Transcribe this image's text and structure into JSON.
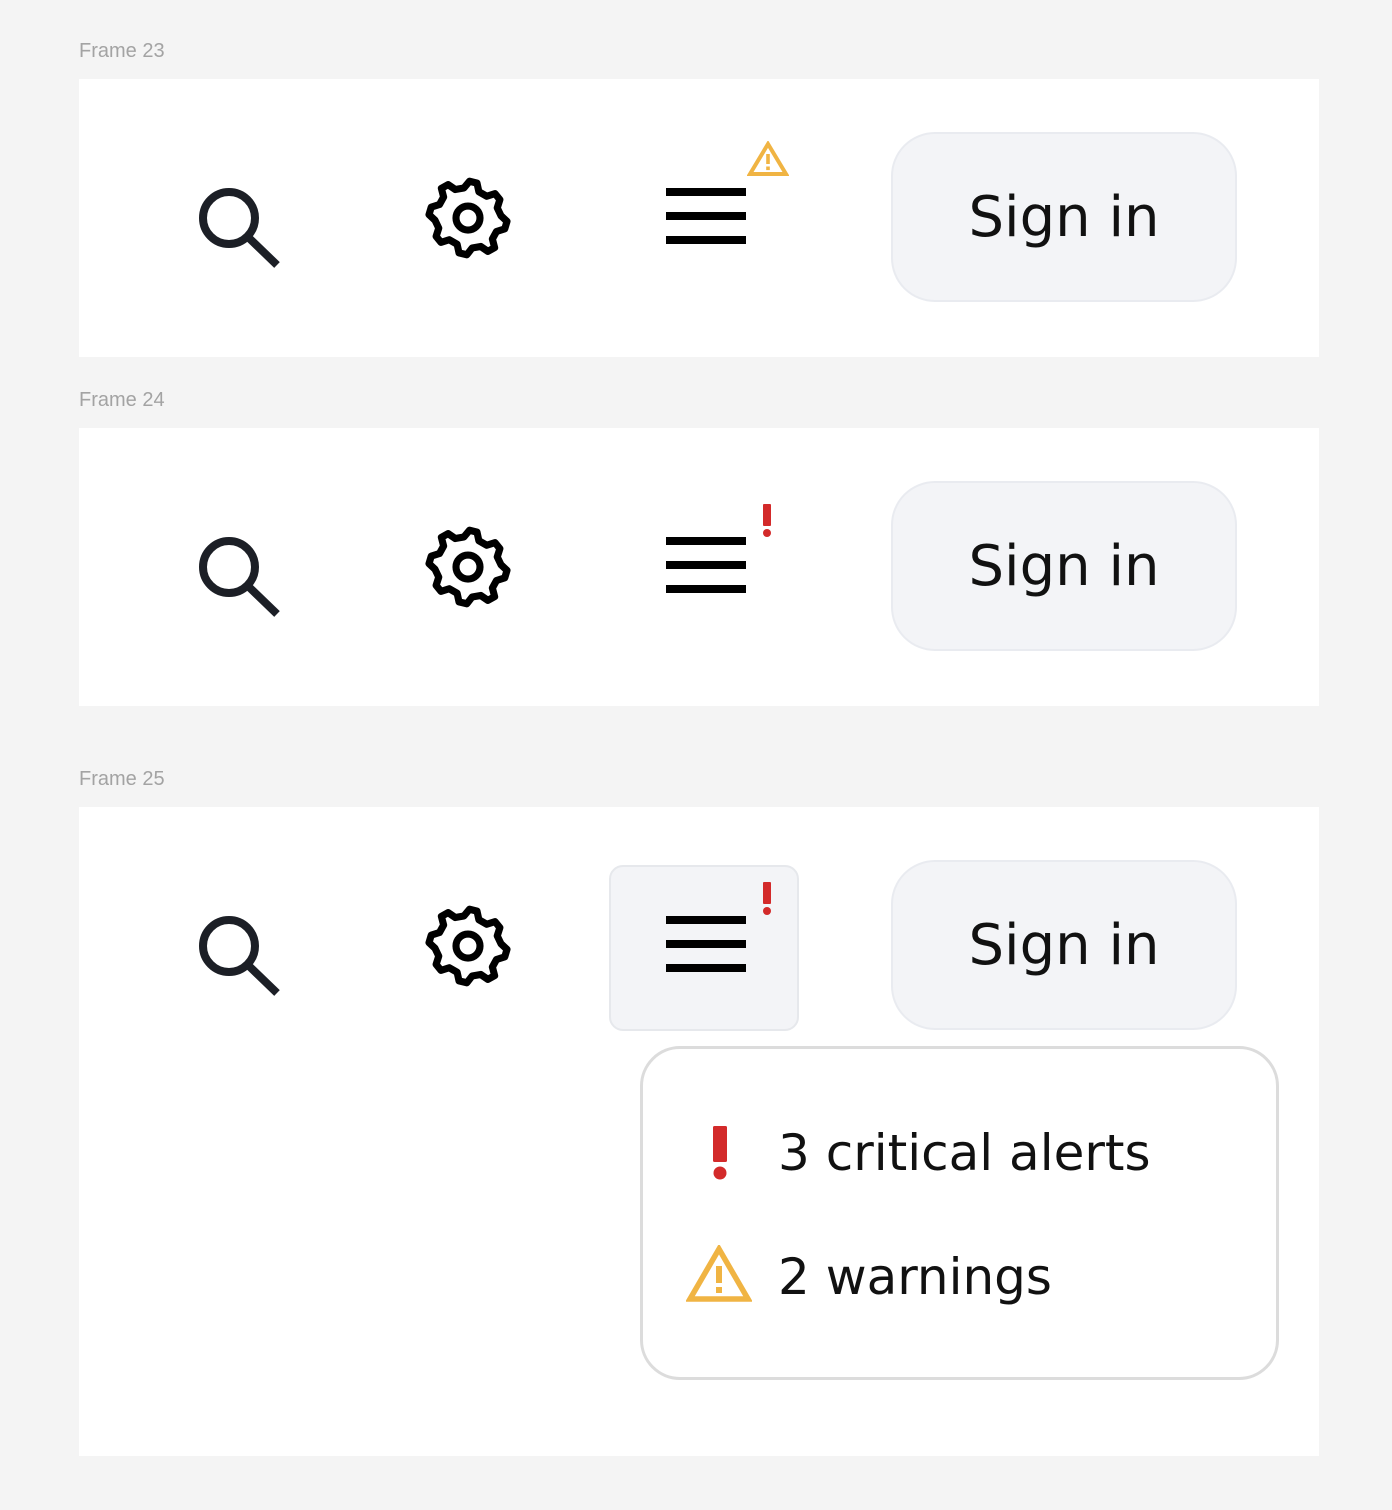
{
  "colors": {
    "background": "#f4f4f4",
    "frame_background": "#ffffff",
    "icon_dark": "#1c1f26",
    "icon_black": "#000000",
    "warning": "#f0b443",
    "critical": "#d32a2a",
    "button_bg": "#f3f4f7",
    "button_border": "#e9ebf0",
    "dropdown_border": "#dcdcdc"
  },
  "frames": [
    {
      "label": "Frame 23",
      "icons": [
        "search-icon",
        "gear-icon",
        "hamburger-menu-icon"
      ],
      "menu_badge": "warning-triangle-icon",
      "signin_label": "Sign in"
    },
    {
      "label": "Frame 24",
      "icons": [
        "search-icon",
        "gear-icon",
        "hamburger-menu-icon"
      ],
      "menu_badge": "exclamation-icon",
      "signin_label": "Sign in"
    },
    {
      "label": "Frame 25",
      "icons": [
        "search-icon",
        "gear-icon",
        "hamburger-menu-icon"
      ],
      "menu_badge": "exclamation-icon",
      "menu_active": true,
      "signin_label": "Sign in",
      "dropdown": {
        "items": [
          {
            "icon": "exclamation-icon",
            "text": "3 critical alerts"
          },
          {
            "icon": "warning-triangle-icon",
            "text": "2 warnings"
          }
        ]
      }
    }
  ]
}
